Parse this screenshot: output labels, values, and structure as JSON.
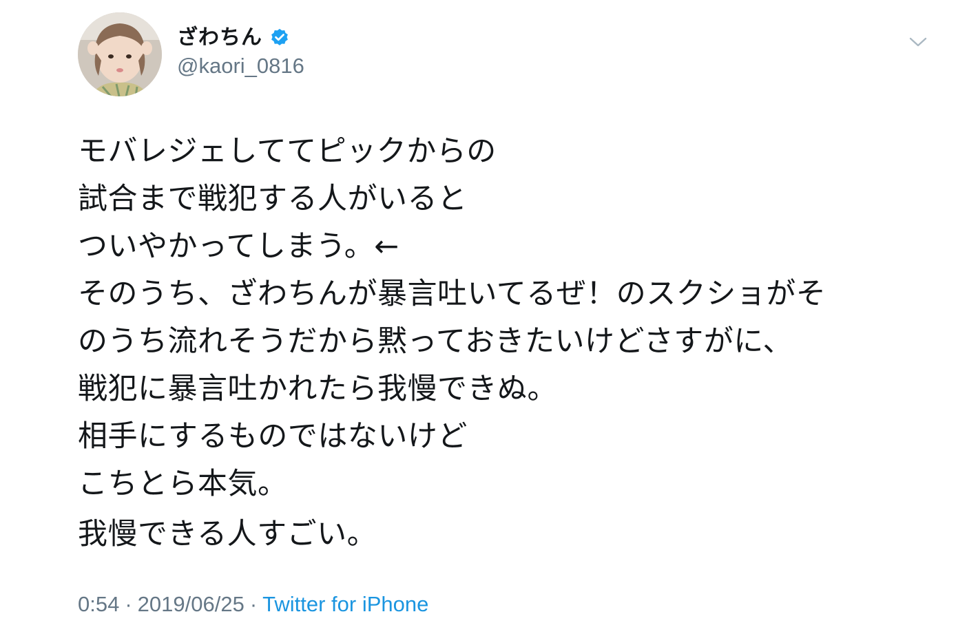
{
  "author": {
    "display_name": "ざわちん",
    "handle": "@kaori_0816",
    "verified": true,
    "avatar_icon": "profile-photo"
  },
  "tweet": {
    "lines": [
      "モバレジェしててピックからの",
      "試合まで戦犯する人がいると",
      "ついやかってしまう。←",
      "そのうち、ざわちんが暴言吐いてるぜ！のスクショがそ",
      "のうち流れそうだから黙っておきたいけどさすがに、",
      "戦犯に暴言吐かれたら我慢できぬ。",
      "相手にするものではないけど",
      "こちとら本気。"
    ],
    "second_paragraph": "我慢できる人すごい。",
    "time": "0:54",
    "date": "2019/06/25",
    "separator": "·",
    "source": "Twitter for iPhone"
  },
  "colors": {
    "text": "#14171a",
    "secondary": "#657786",
    "link": "#1b95e0",
    "verified": "#1da1f2"
  }
}
